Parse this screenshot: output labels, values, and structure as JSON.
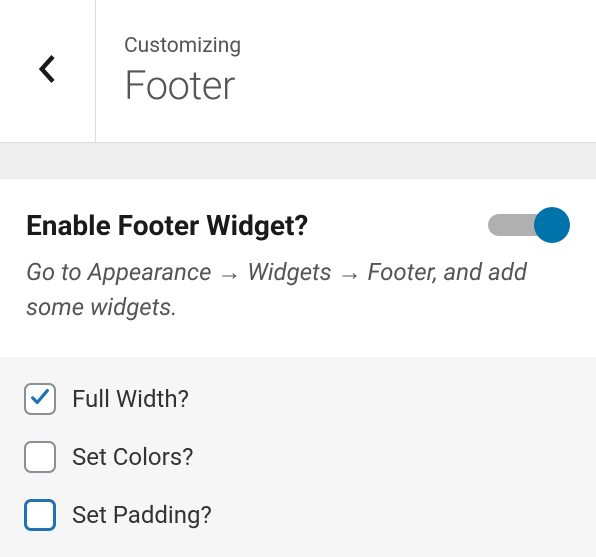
{
  "header": {
    "breadcrumb": "Customizing",
    "title": "Footer"
  },
  "main": {
    "toggle_label": "Enable Footer Widget?",
    "toggle_enabled": true,
    "description": "Go to Appearance → Widgets → Footer, and add some widgets."
  },
  "options": [
    {
      "label": "Full Width?",
      "checked": true,
      "focused": false
    },
    {
      "label": "Set Colors?",
      "checked": false,
      "focused": false
    },
    {
      "label": "Set Padding?",
      "checked": false,
      "focused": true
    }
  ],
  "colors": {
    "accent": "#0073aa",
    "focus": "#2271b1"
  }
}
